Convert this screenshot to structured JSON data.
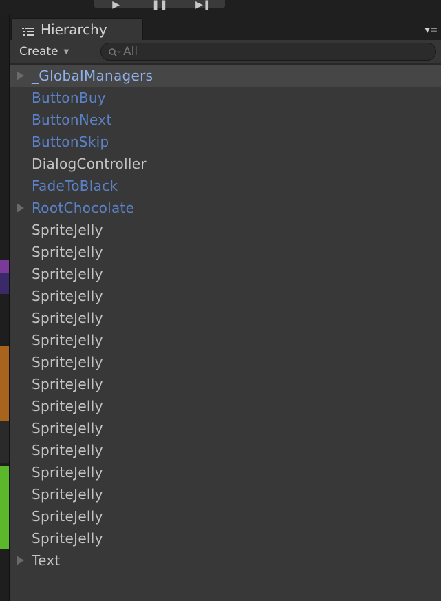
{
  "window": {
    "tab_title": "Hierarchy",
    "tab_icon": "hierarchy-list-icon",
    "menu_icon": "panel-menu-icon"
  },
  "toolbar": {
    "create_label": "Create",
    "search_placeholder": "All",
    "search_icon": "search-icon"
  },
  "play_controls": [
    "play",
    "pause",
    "step"
  ],
  "colors": {
    "prefab_text": "#5b82c8",
    "normal_text": "#c4c4c4",
    "panel_bg": "#383838",
    "selected_row_bg": "#464646"
  },
  "items": [
    {
      "label": "_GlobalManagers",
      "prefab": true,
      "expandable": true,
      "selected": true
    },
    {
      "label": "ButtonBuy",
      "prefab": true,
      "expandable": false
    },
    {
      "label": "ButtonNext",
      "prefab": true,
      "expandable": false
    },
    {
      "label": "ButtonSkip",
      "prefab": true,
      "expandable": false
    },
    {
      "label": "DialogController",
      "prefab": false,
      "expandable": false
    },
    {
      "label": "FadeToBlack",
      "prefab": true,
      "expandable": false
    },
    {
      "label": "RootChocolate",
      "prefab": true,
      "expandable": true
    },
    {
      "label": "SpriteJelly",
      "prefab": false,
      "expandable": false
    },
    {
      "label": "SpriteJelly",
      "prefab": false,
      "expandable": false
    },
    {
      "label": "SpriteJelly",
      "prefab": false,
      "expandable": false
    },
    {
      "label": "SpriteJelly",
      "prefab": false,
      "expandable": false
    },
    {
      "label": "SpriteJelly",
      "prefab": false,
      "expandable": false
    },
    {
      "label": "SpriteJelly",
      "prefab": false,
      "expandable": false
    },
    {
      "label": "SpriteJelly",
      "prefab": false,
      "expandable": false
    },
    {
      "label": "SpriteJelly",
      "prefab": false,
      "expandable": false
    },
    {
      "label": "SpriteJelly",
      "prefab": false,
      "expandable": false
    },
    {
      "label": "SpriteJelly",
      "prefab": false,
      "expandable": false
    },
    {
      "label": "SpriteJelly",
      "prefab": false,
      "expandable": false
    },
    {
      "label": "SpriteJelly",
      "prefab": false,
      "expandable": false
    },
    {
      "label": "SpriteJelly",
      "prefab": false,
      "expandable": false
    },
    {
      "label": "SpriteJelly",
      "prefab": false,
      "expandable": false
    },
    {
      "label": "SpriteJelly",
      "prefab": false,
      "expandable": false
    },
    {
      "label": "Text",
      "prefab": false,
      "expandable": true
    }
  ]
}
